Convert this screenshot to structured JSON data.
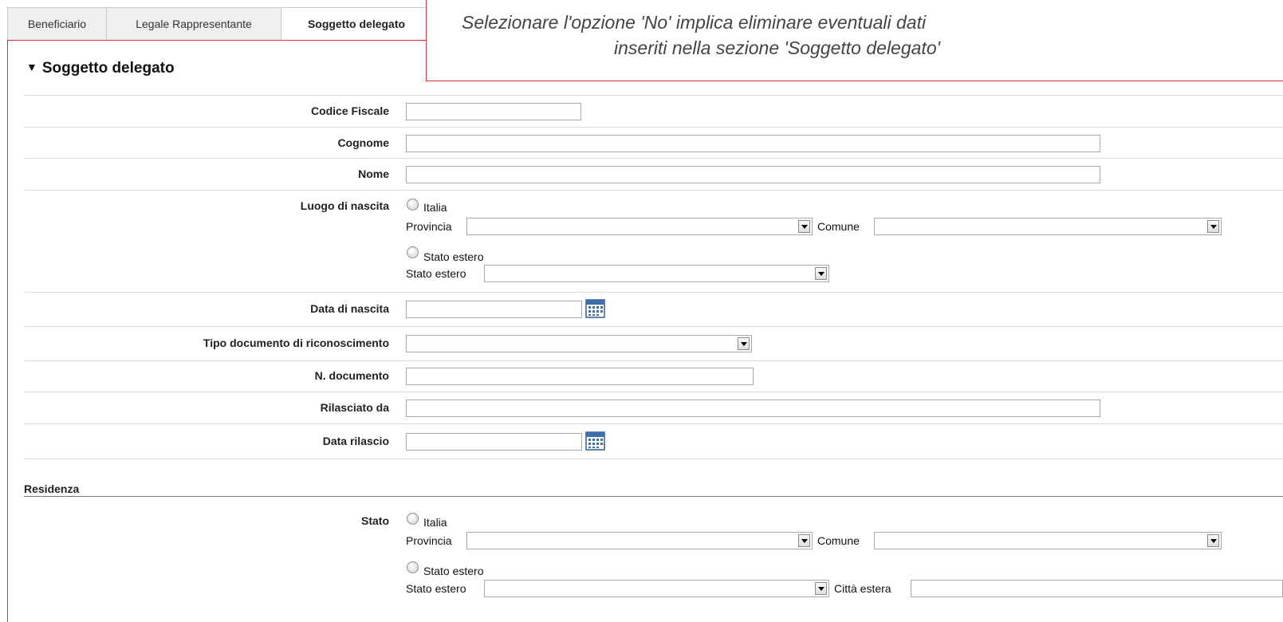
{
  "tabs": [
    {
      "label": "Beneficiario"
    },
    {
      "label": "Legale Rappresentante"
    },
    {
      "label": "Soggetto delegato",
      "active": true
    }
  ],
  "tooltip": {
    "line1": "Selezionare l'opzione 'No' implica eliminare eventuali dati",
    "line2": "inseriti nella sezione 'Soggetto delegato'"
  },
  "section": {
    "title": "Soggetto delegato",
    "fields": {
      "codice_fiscale": {
        "label": "Codice Fiscale",
        "value": ""
      },
      "cognome": {
        "label": "Cognome",
        "value": ""
      },
      "nome": {
        "label": "Nome",
        "value": ""
      },
      "luogo_nascita": {
        "label": "Luogo di nascita",
        "italia": "Italia",
        "provincia": "Provincia",
        "comune": "Comune",
        "stato_estero_radio": "Stato estero",
        "stato_estero": "Stato estero"
      },
      "data_nascita": {
        "label": "Data di nascita",
        "value": ""
      },
      "tipo_documento": {
        "label": "Tipo documento di riconoscimento",
        "value": ""
      },
      "n_documento": {
        "label": "N. documento",
        "value": ""
      },
      "rilasciato_da": {
        "label": "Rilasciato da",
        "value": ""
      },
      "data_rilascio": {
        "label": "Data rilascio",
        "value": ""
      }
    }
  },
  "residenza": {
    "title": "Residenza",
    "stato": {
      "label": "Stato",
      "italia": "Italia",
      "provincia": "Provincia",
      "comune": "Comune",
      "stato_estero_radio": "Stato estero",
      "stato_estero": "Stato estero",
      "citta_estera": "Città estera"
    }
  },
  "icons": {
    "calendar": "calendar-icon",
    "dropdown": "chevron-down-icon",
    "section_toggle": "triangle-down-icon"
  },
  "colors": {
    "frame_border": "#d9323b",
    "calendar": "#3d6fa8"
  }
}
